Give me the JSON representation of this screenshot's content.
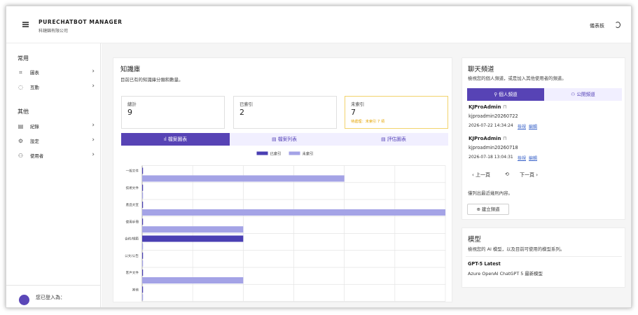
{
  "app": {
    "title": "PURECHATBOT MANAGER",
    "company": "科鏈錦有限公司"
  },
  "topbar": {
    "dashboard_link": "儀表板",
    "avatar_icon": "user-icon"
  },
  "sidebar": {
    "section_common": "常用",
    "common_items": [
      {
        "label": "圖表",
        "icon": "chart-icon"
      },
      {
        "label": "互動",
        "icon": "chat-icon"
      }
    ],
    "section_other": "其他",
    "other_items": [
      {
        "label": "紀錄",
        "icon": "log-icon"
      },
      {
        "label": "設定",
        "icon": "gear-icon"
      },
      {
        "label": "使用者",
        "icon": "users-icon"
      }
    ],
    "footer_text": "您已登入為："
  },
  "knowledge": {
    "title": "知識庫",
    "desc": "目前已有的知識庫分類和數量。",
    "stats": [
      {
        "label": "總計",
        "value": "9"
      },
      {
        "label": "已索引",
        "value": "2"
      },
      {
        "label": "未索引",
        "value": "7",
        "note": "待處理：未索引 7 項"
      }
    ],
    "tabs": [
      "檔案圖表",
      "檔案列表",
      "評估圖表"
    ]
  },
  "chart_data": {
    "type": "bar",
    "orientation": "horizontal",
    "categories": [
      "一般文件",
      "技術文件",
      "產品文宣",
      "使用手冊",
      "合約/規範",
      "公文/公告",
      "客戶文件",
      "其他"
    ],
    "series": [
      {
        "name": "已索引",
        "values": [
          0,
          0,
          0,
          0,
          1,
          0,
          0,
          0
        ],
        "color": "#4a3fb3"
      },
      {
        "name": "未索引",
        "values": [
          2,
          0,
          3,
          1,
          0,
          0,
          1,
          0
        ],
        "color": "#a4a3e6"
      }
    ],
    "xlim": [
      0,
      3
    ],
    "grid": true,
    "legend": "top-center"
  },
  "channels": {
    "title": "聊天頻道",
    "desc": "檢視您的個人頻道，或是加入其他使用者的頻道。",
    "tabs": [
      "個人頻道",
      "公開頻道"
    ],
    "items": [
      {
        "name": "KJProAdmin",
        "id": "kjproadmin20260722",
        "time": "2026-07-22 14:34:24",
        "view": "檢視",
        "edit": "編輯"
      },
      {
        "name": "KJProAdmin",
        "id": "kjproadmin20260718",
        "time": "2026-07-18 13:04:31",
        "view": "檢視",
        "edit": "編輯"
      }
    ],
    "prev": "上一頁",
    "next": "下一頁",
    "note": "僅列出最近幾則內容。",
    "create_button": "建立頻道"
  },
  "models": {
    "title": "模型",
    "desc": "檢視您的 AI 模型，以及目前可使用的模型系列。",
    "items": [
      {
        "name": "GPT-5 Latest",
        "desc": "Azure OpenAI ChatGPT 5 最新模型"
      }
    ]
  }
}
